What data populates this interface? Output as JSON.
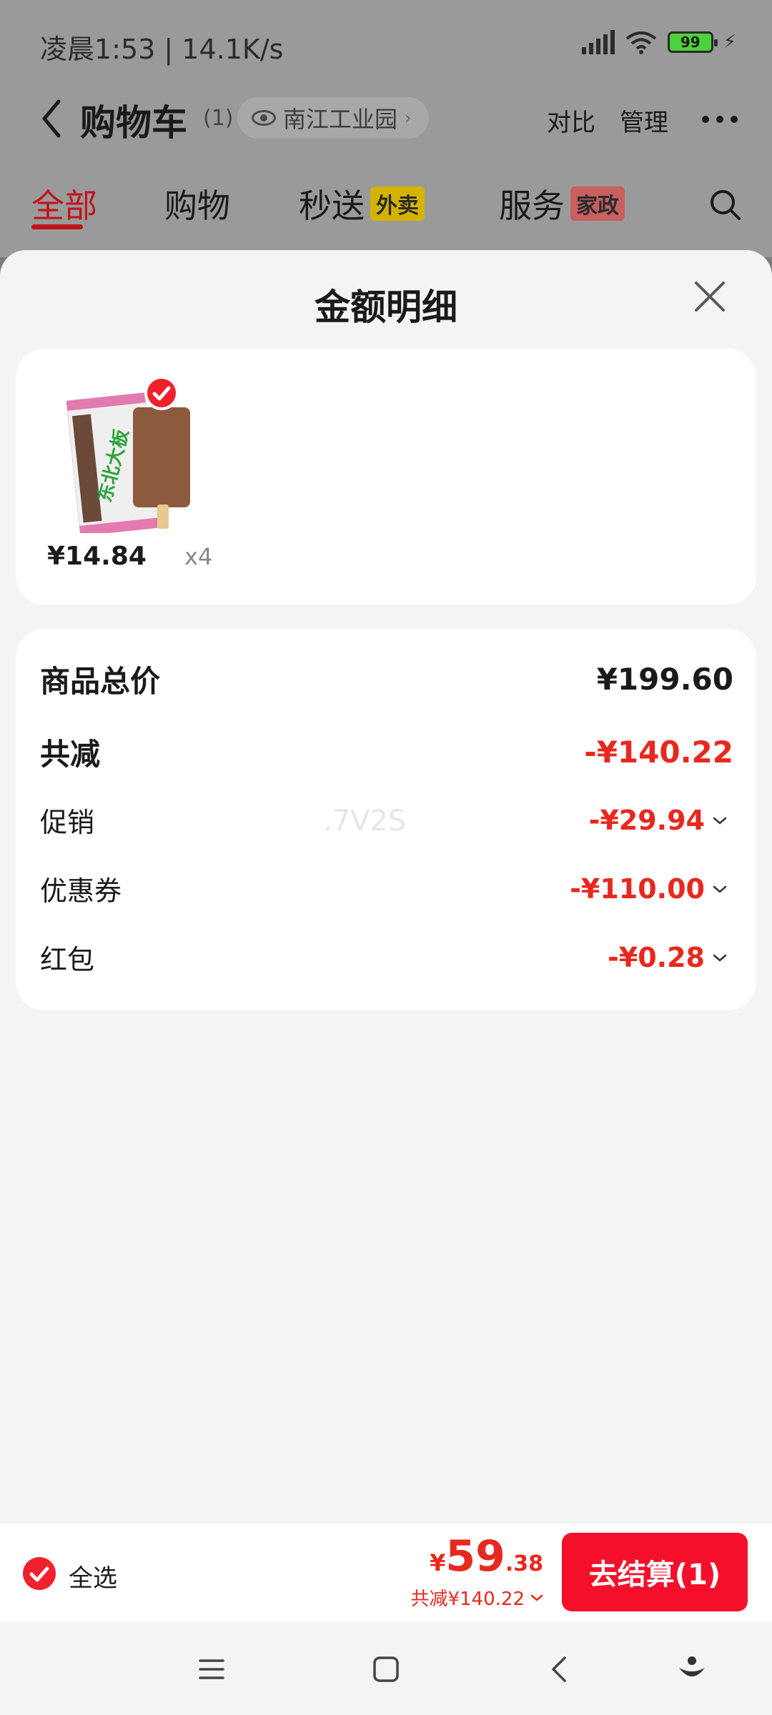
{
  "status_bar": {
    "time_speed": "凌晨1:53 | 14.1K/s",
    "battery": "99"
  },
  "nav": {
    "title": "购物车",
    "count": "(1)",
    "location": "南江工业园",
    "compare": "对比",
    "manage": "管理"
  },
  "tabs": [
    {
      "label": "全部",
      "tag": ""
    },
    {
      "label": "购物",
      "tag": ""
    },
    {
      "label": "秒送",
      "tag": "外卖"
    },
    {
      "label": "服务",
      "tag": "家政"
    }
  ],
  "sheet": {
    "title": "金额明细",
    "item": {
      "price": "¥14.84",
      "quantity": "x4"
    },
    "rows": {
      "total_label": "商品总价",
      "total_value": "¥199.60",
      "reduction_label": "共减",
      "reduction_value": "-¥140.22",
      "promo_label": "促销",
      "promo_value": "-¥29.94",
      "coupon_label": "优惠券",
      "coupon_value": "-¥110.00",
      "redpacket_label": "红包",
      "redpacket_value": "-¥0.28"
    },
    "watermark": ".7V2S"
  },
  "action_bar": {
    "select_all": "全选",
    "currency": "¥",
    "price_int": "59",
    "price_dec": ".38",
    "saved": "共减¥140.22",
    "checkout": "去结算(1)"
  },
  "colors": {
    "accent_red": "#f4102a",
    "price_red": "#e8281e"
  }
}
